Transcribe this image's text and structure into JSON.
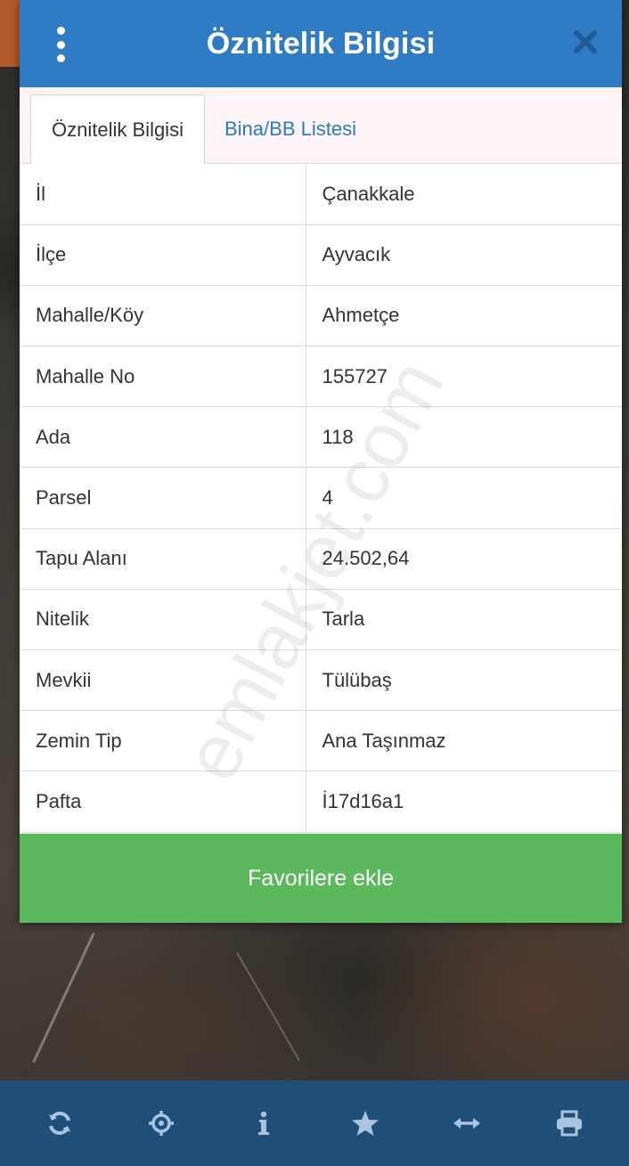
{
  "dialog": {
    "title": "Öznitelik Bilgisi",
    "tabs": [
      {
        "label": "Öznitelik Bilgisi",
        "active": true
      },
      {
        "label": "Bina/BB Listesi",
        "active": false
      }
    ],
    "rows": [
      {
        "key": "İl",
        "value": "Çanakkale"
      },
      {
        "key": "İlçe",
        "value": "Ayvacık"
      },
      {
        "key": "Mahalle/Köy",
        "value": "Ahmetçe"
      },
      {
        "key": "Mahalle No",
        "value": "155727"
      },
      {
        "key": "Ada",
        "value": "118"
      },
      {
        "key": "Parsel",
        "value": "4"
      },
      {
        "key": "Tapu Alanı",
        "value": "24.502,64"
      },
      {
        "key": "Nitelik",
        "value": "Tarla"
      },
      {
        "key": "Mevkii",
        "value": "Tülübaş"
      },
      {
        "key": "Zemin Tip",
        "value": "Ana Taşınmaz"
      },
      {
        "key": "Pafta",
        "value": "İ17d16a1"
      }
    ],
    "favorite_button": "Favorilere ekle",
    "watermark": "emlakjet.com"
  },
  "toolbar": {
    "items": [
      "refresh-icon",
      "locate-icon",
      "info-icon",
      "star-icon",
      "measure-icon",
      "print-icon"
    ]
  },
  "colors": {
    "header": "#2f7bc4",
    "tab_link": "#2a7bbf",
    "favorite": "#5cb85c",
    "toolbar": "#1f4f78",
    "toolbar_icon": "#aac4e0"
  }
}
